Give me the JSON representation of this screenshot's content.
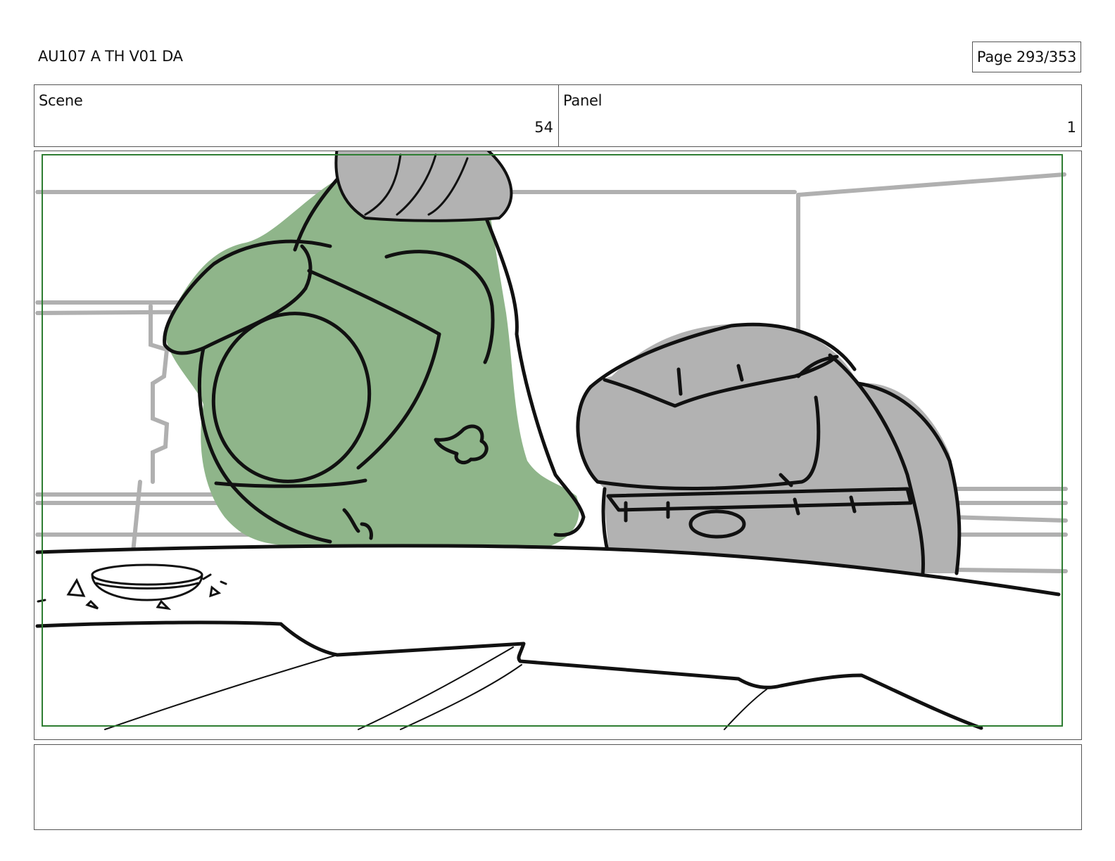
{
  "header": {
    "title": "AU107 A TH V01 DA",
    "page": "Page 293/353"
  },
  "info": {
    "scene_label": "Scene",
    "scene_value": "54",
    "panel_label": "Panel",
    "panel_value": "1"
  },
  "panel": {
    "frame_color": "#2e7d32",
    "green_fill": "#8fb58a",
    "gray_fill": "#b2b2b2",
    "line_color": "#111111",
    "bg_line_color": "#b0b0b0"
  },
  "notes": {
    "text": ""
  }
}
